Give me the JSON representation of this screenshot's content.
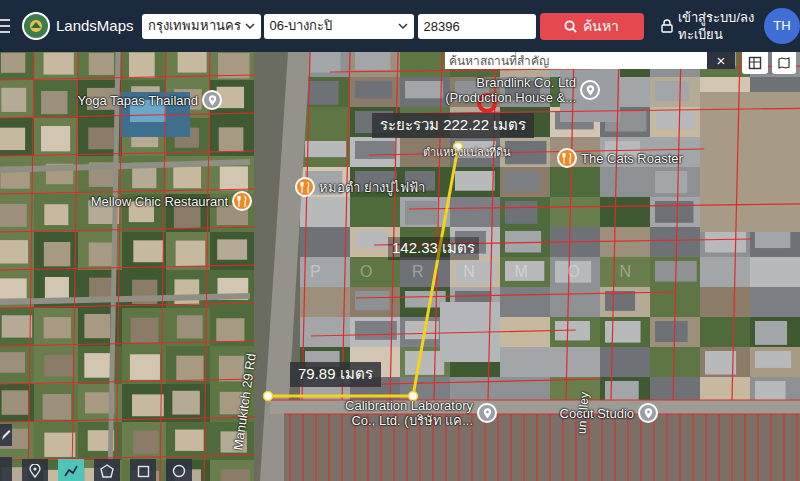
{
  "header": {
    "logo": "LandsMaps",
    "province": "กรุงเทพมหานคร",
    "district": "06-บางกะปิ",
    "parcel_number": "28396",
    "search_button": "ค้นหา",
    "login": [
      "เข้าสู่ระบบ/ลง",
      "ทะเบียน"
    ],
    "language": "TH"
  },
  "place_search": {
    "placeholder": "ค้นหาสถานที่สำคัญ",
    "clear": "×"
  },
  "measurement": {
    "total": "ระยะรวม 222.22 เมตร",
    "segments": [
      "142.33 เมตร",
      "79.89 เมตร"
    ]
  },
  "parcel_marker": {
    "label": "ตำแหน่งแปลงที่ดิน"
  },
  "places": [
    {
      "kind": "place",
      "lines": [
        "Yoga Tapas Thailand"
      ]
    },
    {
      "kind": "restaurant",
      "lines": [
        "Mellow Chic Restaurant"
      ]
    },
    {
      "kind": "restaurant",
      "lines": [
        "หมอตำ ย่างปูไฟฟ้า"
      ]
    },
    {
      "kind": "place",
      "lines": [
        "Brandlink Co. Ltd",
        "(Production House &..."
      ]
    },
    {
      "kind": "restaurant",
      "lines": [
        "The Cats Roaster"
      ]
    },
    {
      "kind": "place",
      "lines": [
        "Calibration Laboratory",
        "Co., Ltd. (บริษัท แค..."
      ]
    },
    {
      "kind": "place",
      "lines": [
        "Cocut Studio"
      ]
    }
  ],
  "roads": [
    "Manukitch 29 Rd",
    "un Alley"
  ],
  "watermark": "P O R N M O N"
}
